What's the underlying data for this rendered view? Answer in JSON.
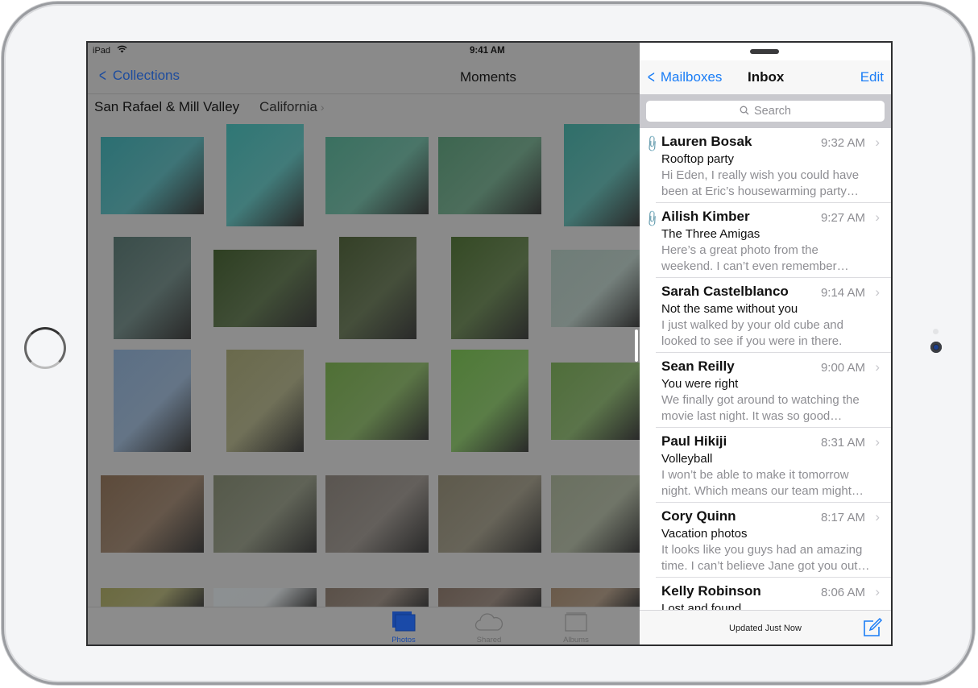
{
  "device": {
    "home_button": "home-button",
    "camera": "front-camera"
  },
  "photos_app": {
    "status_bar": {
      "carrier": "iPad",
      "wifi_icon": "wifi-icon",
      "time": "9:41 AM"
    },
    "nav": {
      "back_label": "Collections",
      "title": "Moments"
    },
    "moment": {
      "place": "San Rafael & Mill Valley",
      "region": "California",
      "region_chevron": "›"
    },
    "thumbnails_colors": [
      [
        "#2b6f72",
        "#2f7775",
        "#3a7060",
        "#3d6650",
        "#2f6f6a"
      ],
      [
        "#3a4d4a",
        "#2e3f22",
        "#344027",
        "#354a25",
        "#6f7d78"
      ],
      [
        "#5b6f85",
        "#6a6a4c",
        "#4f7035",
        "#4e7a36",
        "#4f6e3a"
      ],
      [
        "#5c4a3a",
        "#55594a",
        "#5a5550",
        "#5e5a4c",
        "#6a7060"
      ],
      [
        "#6b6a40",
        "#8c9092",
        "#5a5048",
        "#5a4e46",
        "#6a5a4a"
      ]
    ],
    "tabs": [
      {
        "label": "Photos",
        "icon": "photos-stack-icon",
        "active": true
      },
      {
        "label": "Shared",
        "icon": "cloud-icon",
        "active": false
      },
      {
        "label": "Albums",
        "icon": "album-icon",
        "active": false
      }
    ]
  },
  "mail_app": {
    "nav": {
      "back_label": "Mailboxes",
      "title": "Inbox",
      "edit_label": "Edit"
    },
    "search": {
      "placeholder": "Search"
    },
    "messages": [
      {
        "sender": "Lauren Bosak",
        "time": "9:32 AM",
        "subject": "Rooftop party",
        "preview": "Hi Eden, I really wish you could have been at Eric’s housewarming party…",
        "attachment": true
      },
      {
        "sender": "Ailish Kimber",
        "time": "9:27 AM",
        "subject": "The Three Amigas",
        "preview": "Here’s a great photo from the weekend. I can’t even remember…",
        "attachment": true
      },
      {
        "sender": "Sarah Castelblanco",
        "time": "9:14 AM",
        "subject": "Not the same without you",
        "preview": "I just walked by your old cube and looked to see if you were in there.",
        "attachment": false
      },
      {
        "sender": "Sean Reilly",
        "time": "9:00 AM",
        "subject": "You were right",
        "preview": "We finally got around to watching the movie last night. It was so good…",
        "attachment": false
      },
      {
        "sender": "Paul Hikiji",
        "time": "8:31 AM",
        "subject": "Volleyball",
        "preview": "I won’t be able to make it tomorrow night. Which means our team might…",
        "attachment": false
      },
      {
        "sender": "Cory Quinn",
        "time": "8:17 AM",
        "subject": "Vacation photos",
        "preview": "It looks like you guys had an amazing time. I can’t believe Jane got you out…",
        "attachment": false
      },
      {
        "sender": "Kelly Robinson",
        "time": "8:06 AM",
        "subject": "Lost and found",
        "preview": "",
        "attachment": false
      }
    ],
    "toolbar": {
      "status": "Updated Just Now",
      "compose_icon": "compose-icon"
    },
    "colors": {
      "accent": "#1a7df6",
      "secondary_text": "#8e8e93"
    }
  }
}
